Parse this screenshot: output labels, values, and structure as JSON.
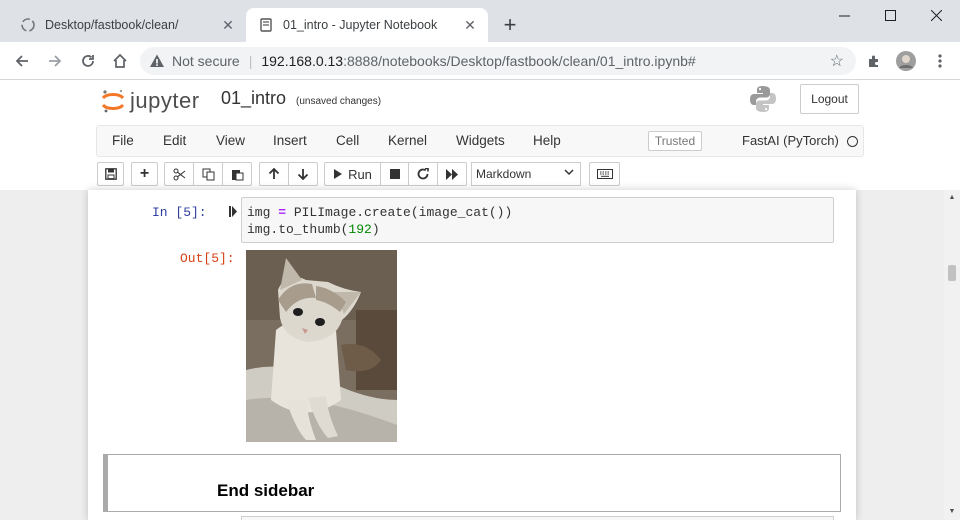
{
  "browser": {
    "tabs": [
      {
        "title": "Desktop/fastbook/clean/",
        "active": false
      },
      {
        "title": "01_intro - Jupyter Notebook",
        "active": true
      }
    ],
    "address": {
      "security_label": "Not secure",
      "url_host": "192.168.0.13",
      "url_rest": ":8888/notebooks/Desktop/fastbook/clean/01_intro.ipynb#"
    }
  },
  "jupyter": {
    "logo_text": "jupyter",
    "notebook_name": "01_intro",
    "save_status": "(unsaved changes)",
    "logout_label": "Logout",
    "menu": [
      "File",
      "Edit",
      "View",
      "Insert",
      "Cell",
      "Kernel",
      "Widgets",
      "Help"
    ],
    "trusted_label": "Trusted",
    "kernel_name": "FastAI (PyTorch)",
    "toolbar": {
      "run_label": "Run",
      "cell_type": "Markdown"
    }
  },
  "cells": {
    "code": {
      "in_prompt": "In [5]:",
      "out_prompt": "Out[5]:",
      "line1_a": "img ",
      "line1_op": "=",
      "line1_b": " PILImage.create(image_cat())",
      "line2_a": "img.to_thumb(",
      "line2_num": "192",
      "line2_b": ")"
    },
    "markdown": {
      "heading": "End sidebar"
    }
  },
  "colors": {
    "in_prompt": "#303f9f",
    "out_prompt": "#d84315",
    "tab_active": "#ffffff",
    "tabstrip": "#dee1e6"
  }
}
